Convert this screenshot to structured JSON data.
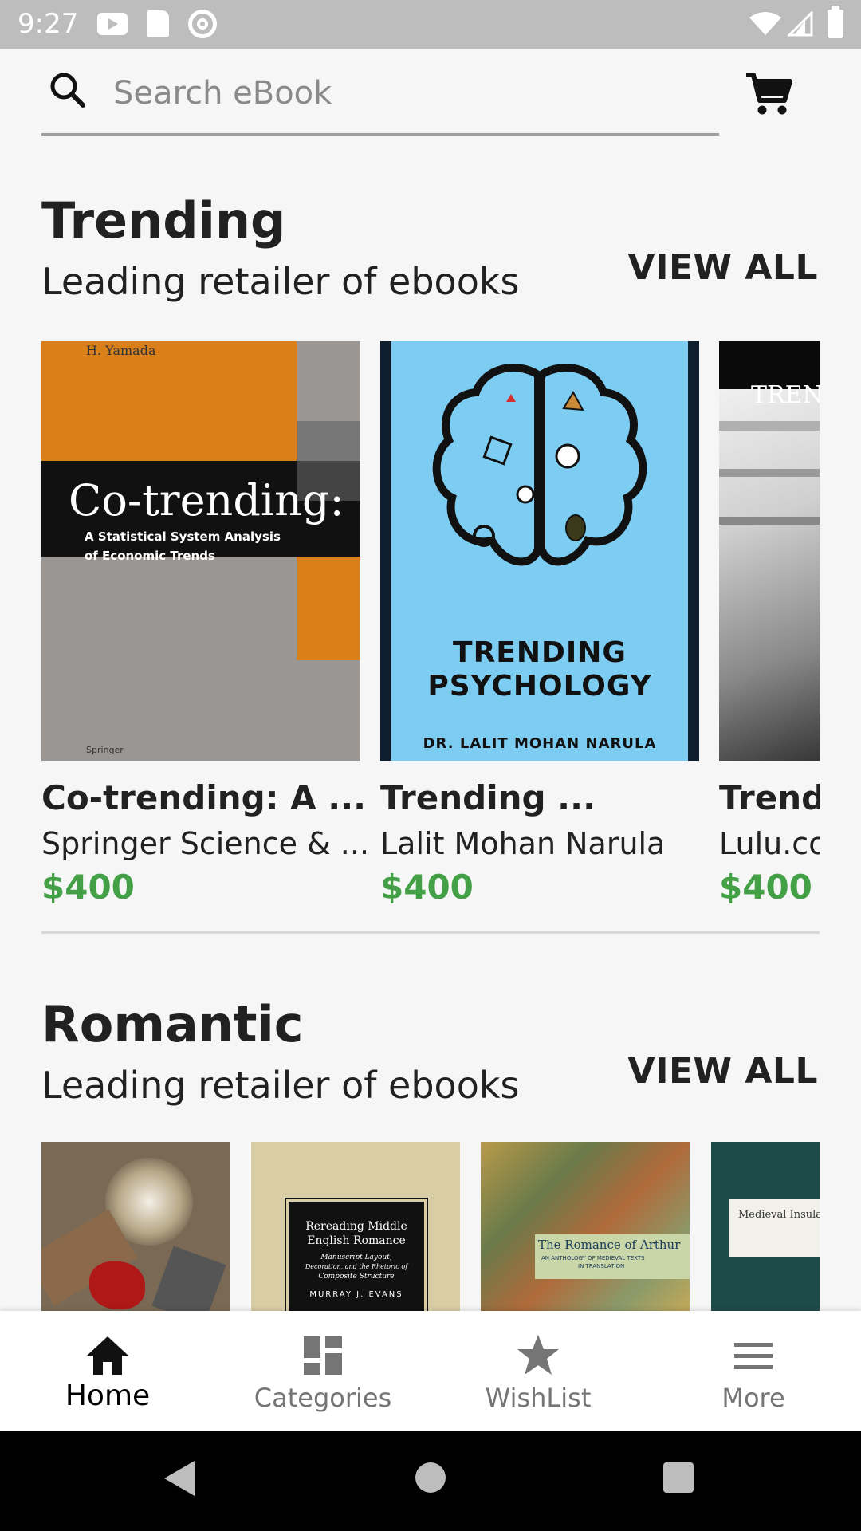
{
  "status_bar": {
    "time": "9:27"
  },
  "search": {
    "placeholder": "Search eBook"
  },
  "sections": [
    {
      "title": "Trending",
      "subtitle": "Leading retailer of ebooks",
      "view_all": "VIEW ALL",
      "books": [
        {
          "title": "Co-trending: A ...",
          "author": "Springer Science & ...",
          "price": "$400",
          "cover": {
            "author": "H. Yamada",
            "title": "Co-trending:",
            "subtitle_line1": "A Statistical System Analysis",
            "subtitle_line2": "of Economic Trends",
            "publisher": "Springer"
          }
        },
        {
          "title": "Trending ...",
          "author": "Lalit Mohan Narula",
          "price": "$400",
          "cover": {
            "title_line1": "TRENDING",
            "title_line2": "PSYCHOLOGY",
            "author": "DR. LALIT MOHAN NARULA"
          }
        },
        {
          "title": "Trendi",
          "author": "Lulu.co",
          "price": "$400",
          "cover": {
            "title": "TREN"
          }
        }
      ]
    },
    {
      "title": "Romantic",
      "subtitle": "Leading retailer of ebooks",
      "view_all": "VIEW ALL",
      "books": [
        {
          "cover": {}
        },
        {
          "cover": {
            "title_line1": "Rereading Middle",
            "title_line2": "English Romance",
            "sub1": "Manuscript Layout,",
            "sub2": "Decoration, and the Rhetoric of",
            "sub3": "Composite Structure",
            "author": "MURRAY J. EVANS"
          }
        },
        {
          "cover": {
            "title": "The Romance of Arthur",
            "sub1": "AN ANTHOLOGY OF MEDIEVAL TEXTS",
            "sub2": "IN TRANSLATION"
          }
        },
        {
          "cover": {
            "title": "Medieval Insula"
          }
        }
      ]
    }
  ],
  "bottom_nav": {
    "items": [
      {
        "label": "Home",
        "icon": "home-icon",
        "active": true
      },
      {
        "label": "Categories",
        "icon": "dashboard-icon"
      },
      {
        "label": "WishList",
        "icon": "star-icon"
      },
      {
        "label": "More",
        "icon": "menu-icon"
      }
    ]
  },
  "colors": {
    "price": "#43a047",
    "status_bar": "#bdbdbd",
    "psych_cover": "#7dcdf2"
  }
}
